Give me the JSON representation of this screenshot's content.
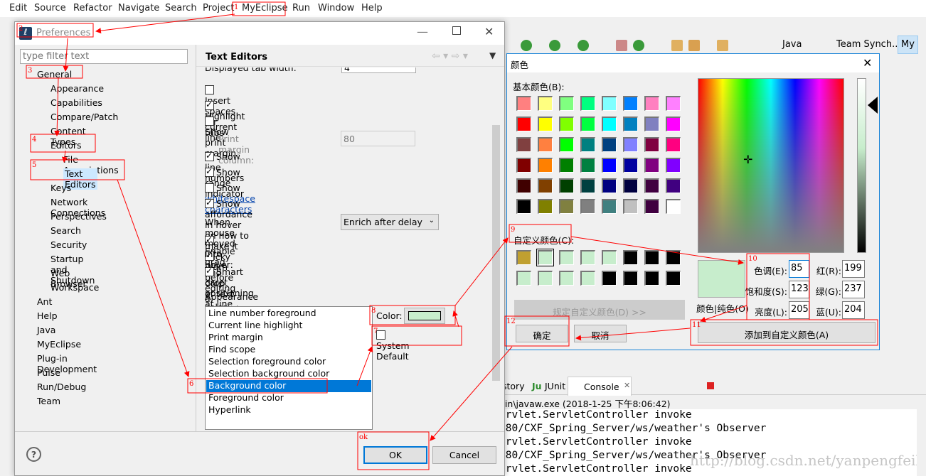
{
  "menubar": {
    "items": [
      "Edit",
      "Source",
      "Refactor",
      "Navigate",
      "Search",
      "Project",
      "MyEclipse",
      "Run",
      "Window",
      "Help"
    ]
  },
  "perspectives": {
    "java": "Java",
    "team": "Team Synch...",
    "my": "My"
  },
  "preferences": {
    "title": "Preferences",
    "filter_placeholder": "type filter text",
    "tree": [
      {
        "label": "General",
        "level": 0
      },
      {
        "label": "Appearance",
        "level": 1
      },
      {
        "label": "Capabilities",
        "level": 1
      },
      {
        "label": "Compare/Patch",
        "level": 1
      },
      {
        "label": "Content Types",
        "level": 1
      },
      {
        "label": "Editors",
        "level": 1
      },
      {
        "label": "File Associations",
        "level": 2
      },
      {
        "label": "Text Editors",
        "level": 2,
        "selected": true
      },
      {
        "label": "Keys",
        "level": 1
      },
      {
        "label": "Network Connections",
        "level": 1
      },
      {
        "label": "Perspectives",
        "level": 1
      },
      {
        "label": "Search",
        "level": 1
      },
      {
        "label": "Security",
        "level": 1
      },
      {
        "label": "Startup and Shutdown",
        "level": 1
      },
      {
        "label": "Web Browser",
        "level": 1
      },
      {
        "label": "Workspace",
        "level": 1
      },
      {
        "label": "Ant",
        "level": 0
      },
      {
        "label": "Help",
        "level": 0
      },
      {
        "label": "Java",
        "level": 0
      },
      {
        "label": "MyEclipse",
        "level": 0
      },
      {
        "label": "Plug-in Development",
        "level": 0
      },
      {
        "label": "Pulse",
        "level": 0
      },
      {
        "label": "Run/Debug",
        "level": 0
      },
      {
        "label": "Team",
        "level": 0
      }
    ],
    "page_title": "Text Editors",
    "tab_width_label": "Displayed tab width:",
    "tab_width_value": "4",
    "options": [
      {
        "label": "Insert spaces for tabs",
        "checked": false
      },
      {
        "label": "Highlight current line",
        "checked": true
      },
      {
        "label": "Show print margin",
        "checked": false
      },
      {
        "label": "Show line numbers",
        "checked": true
      },
      {
        "label": "Show range indicator",
        "checked": true
      },
      {
        "label": "Show ",
        "link": "whitespace characters",
        "checked": false
      },
      {
        "label": "Show affordance in hover on how to make it sticky",
        "checked": true
      },
      {
        "label": "Enable drag and drop of text",
        "checked": true
      },
      {
        "label": "Warn before editing a derived file",
        "checked": true
      },
      {
        "label": "Smart caret positioning at line start and end",
        "checked": true
      }
    ],
    "print_margin_label": "Print margin column:",
    "print_margin_value": "80",
    "hover_label": "When mouse moved into hover:",
    "hover_value": "Enrich after delay",
    "appearance_label": "Appearance color options:",
    "color_options": [
      "Line number foreground",
      "Current line highlight",
      "Print margin",
      "Find scope",
      "Selection foreground color",
      "Selection background color",
      "Background color",
      "Foreground color",
      "Hyperlink"
    ],
    "selected_option": "Background color",
    "color_label": "Color:",
    "color_value": "#c7edcc",
    "system_default_label": "System Default",
    "ok": "OK",
    "cancel": "Cancel"
  },
  "color_dialog": {
    "title": "颜色",
    "basic_label": "基本颜色(B):",
    "basic_colors": [
      "#ff8080",
      "#ffff80",
      "#80ff80",
      "#00ff80",
      "#80ffff",
      "#0080ff",
      "#ff80c0",
      "#ff80ff",
      "#ff0000",
      "#ffff00",
      "#80ff00",
      "#00ff40",
      "#00ffff",
      "#0080c0",
      "#8080c0",
      "#ff00ff",
      "#804040",
      "#ff8040",
      "#00ff00",
      "#008080",
      "#004080",
      "#8080ff",
      "#800040",
      "#ff0080",
      "#800000",
      "#ff8000",
      "#008000",
      "#008040",
      "#0000ff",
      "#0000a0",
      "#800080",
      "#8000ff",
      "#400000",
      "#804000",
      "#004000",
      "#004040",
      "#000080",
      "#000040",
      "#400040",
      "#400080",
      "#000000",
      "#808000",
      "#808040",
      "#808080",
      "#408080",
      "#c0c0c0",
      "#400040",
      "#ffffff"
    ],
    "custom_label": "自定义颜色(C):",
    "custom_colors": [
      "#c0a030",
      "#c7edcc",
      "#c7edcc",
      "#c7edcc",
      "#c7edcc",
      "#000000",
      "#000000",
      "#000000",
      "#c7edcc",
      "#c7edcc",
      "#c7edcc",
      "#c7edcc",
      "#000000",
      "#000000",
      "#000000",
      "#000000"
    ],
    "define_button": "规定自定义颜色(D) >>",
    "preview_label": "颜色|纯色(O)",
    "preview_color": "#c7edcc",
    "hue_label": "色调(E):",
    "hue": "85",
    "sat_label": "饱和度(S):",
    "sat": "123",
    "lum_label": "亮度(L):",
    "lum": "205",
    "red_label": "红(R):",
    "red": "199",
    "green_label": "绿(G):",
    "green": "237",
    "blue_label": "蓝(U):",
    "blue": "204",
    "ok": "确定",
    "cancel": "取消",
    "add_button": "添加到自定义颜色(A)"
  },
  "console": {
    "tabs": [
      "story",
      "JUnit",
      "Console"
    ],
    "process": "bin\\javaw.exe (2018-1-25 下午8:06:42)",
    "lines": [
      "ervlet.ServletController invoke",
      "080/CXF_Spring_Server/ws/weather's Observer",
      "ervlet.ServletController invoke",
      "080/CXF_Spring_Server/ws/weather's Observer",
      "ervlet.ServletController invoke"
    ],
    "watermark": "http://blog.csdn.net/yanpengfeil"
  },
  "annotations": [
    "1",
    "2",
    "3",
    "4",
    "5",
    "6",
    "7",
    "8",
    "9",
    "10",
    "11",
    "12",
    "ok"
  ],
  "accent": "#0078d7",
  "annotation_color": "#ff0000"
}
